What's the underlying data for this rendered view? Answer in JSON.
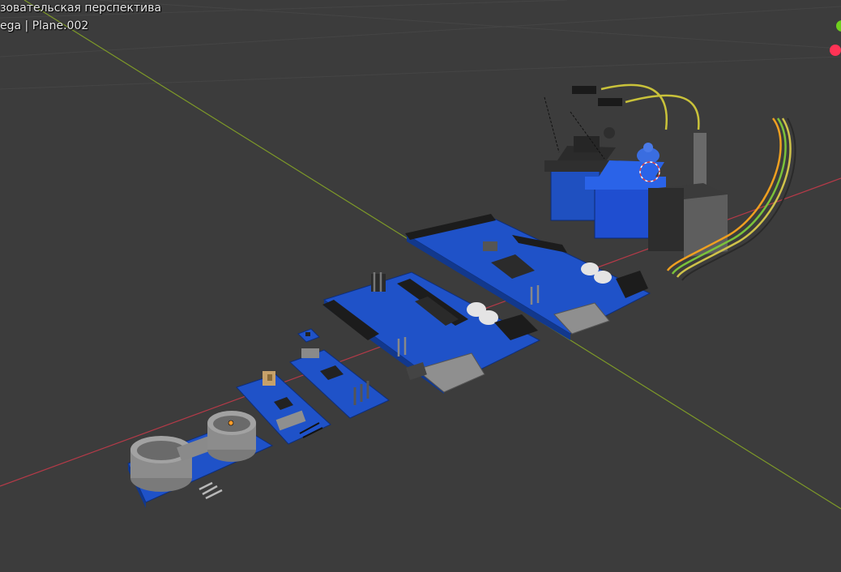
{
  "viewport": {
    "view_name": "зовательская перспектива",
    "object_info": "ega | Plane.002"
  },
  "colors": {
    "background": "#3c3c3c",
    "grid_line": "#454545",
    "axis_x": "#b53a48",
    "axis_y": "#7e9a28",
    "pcb_blue": "#1f52c8",
    "gizmo_x": "#ff3355",
    "gizmo_y": "#6fcf1e"
  },
  "scene_objects": [
    "ultrasonic-sensor",
    "arduino-nano-1",
    "arduino-nano-2",
    "tiny-module",
    "arduino-uno",
    "arduino-mega",
    "servo-black",
    "servo-blue",
    "stepper-motor",
    "wire-bundle"
  ]
}
